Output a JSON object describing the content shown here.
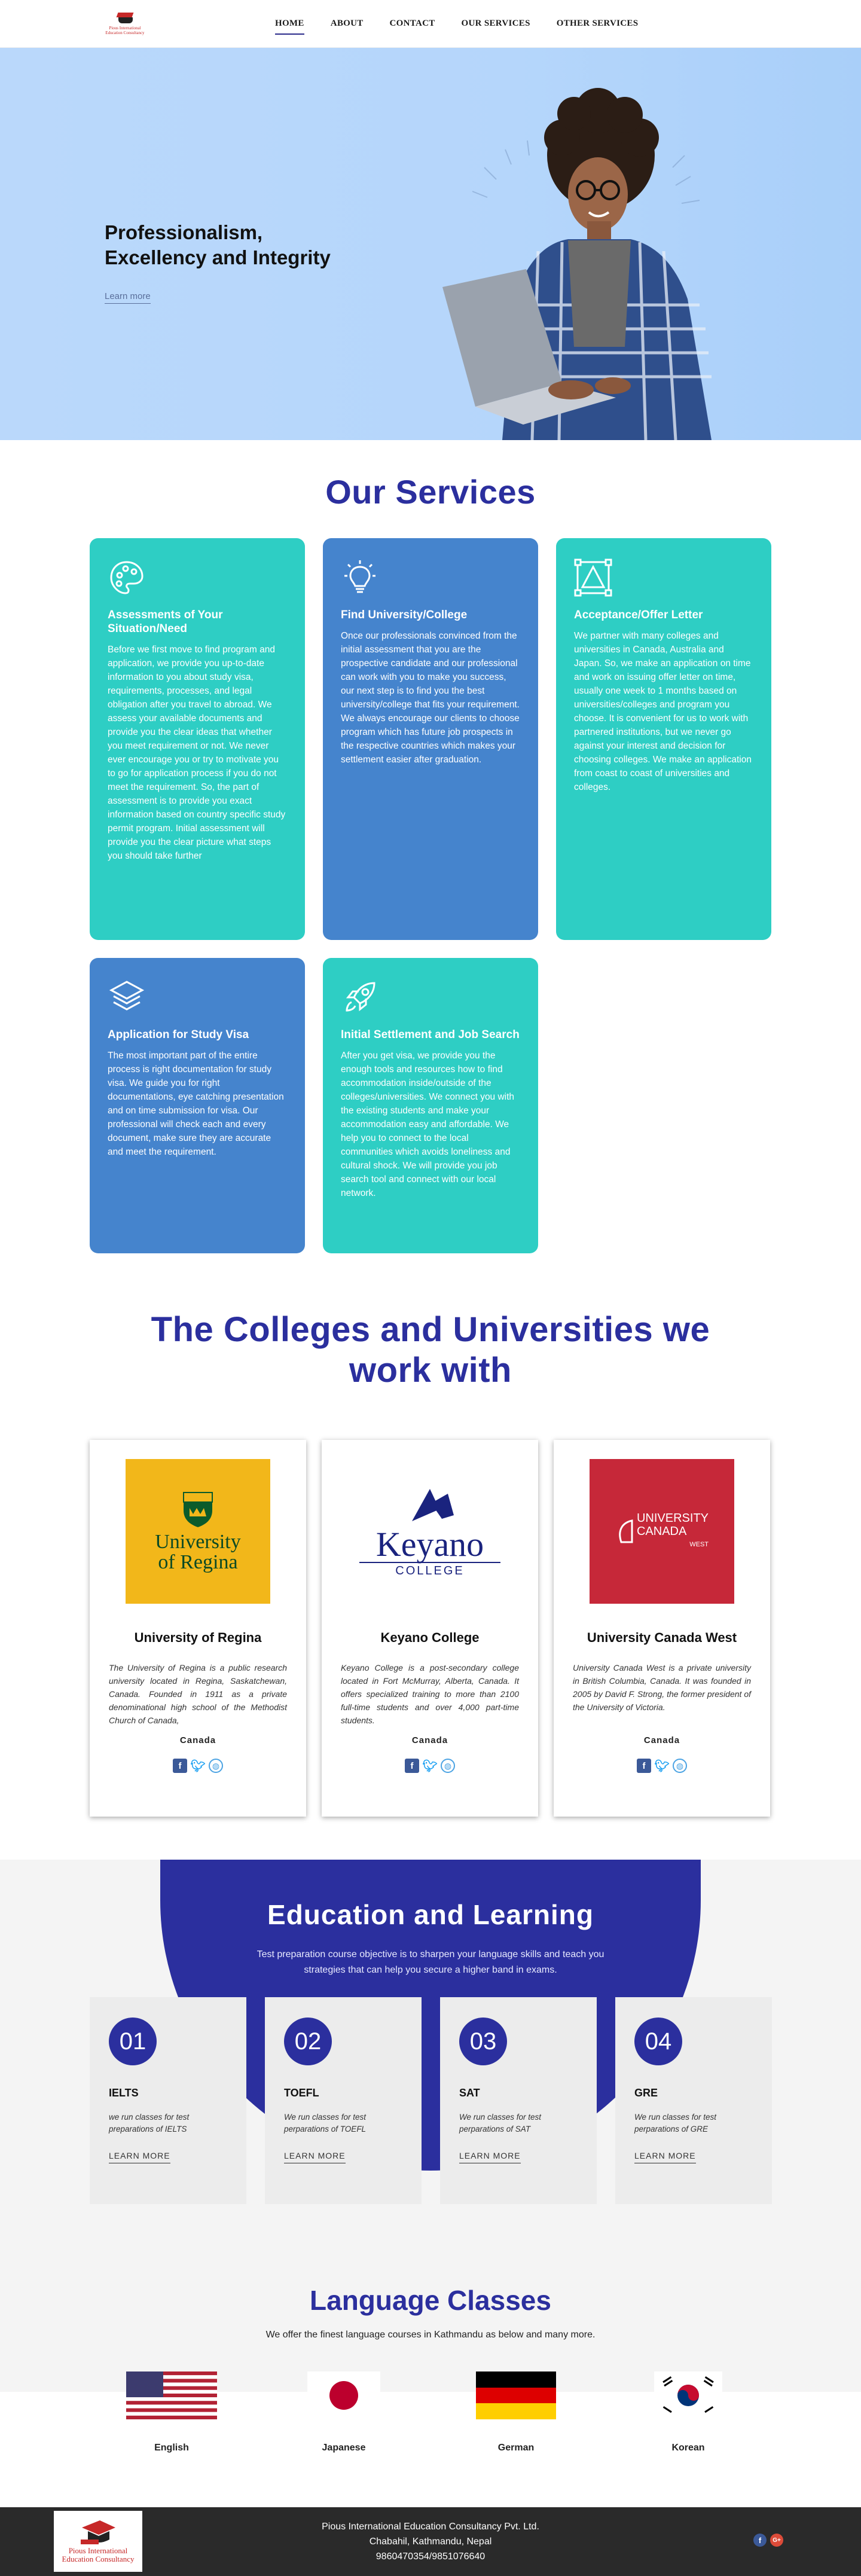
{
  "brand": {
    "logo_line1": "Pious International",
    "logo_line2": "Education Consultancy"
  },
  "nav": {
    "items": [
      "HOME",
      "ABOUT",
      "CONTACT",
      "OUR SERVICES",
      "OTHER SERVICES"
    ]
  },
  "hero": {
    "heading_line1": "Professionalism,",
    "heading_line2": "Excellency and Integrity",
    "cta": "Learn more"
  },
  "services": {
    "title": "Our Services",
    "cards": [
      {
        "title": "Assessments of Your Situation/Need",
        "icon": "palette-icon",
        "color": "#2ecec4",
        "text": "Before we first move to find program and application, we provide you up-to-date information to you about study visa, requirements, processes, and legal obligation after you travel to abroad. We assess your available documents and provide you the clear ideas that whether you meet requirement or not. We never ever encourage you or try to motivate you to go for application process if you do not meet the requirement. So, the part of assessment is to provide you exact information based on country specific study permit program. Initial assessment will provide you the clear picture what steps you should take further"
      },
      {
        "title": "Find University/College",
        "icon": "lightbulb-icon",
        "color": "#4584cd",
        "text": "Once our professionals convinced from the initial assessment that you are the prospective candidate and our professional can work with you to make you success, our next step is to find you the best university/college that fits your requirement. We always encourage our clients to choose program which has future job prospects in the respective countries which makes your settlement easier after graduation."
      },
      {
        "title": "Acceptance/Offer Letter",
        "icon": "vector-triangle-icon",
        "color": "#2ecec4",
        "text": "We partner with many colleges and universities in Canada, Australia and Japan. So, we make an application on time and work on issuing offer letter on time, usually one week to 1 months based on universities/colleges and program you choose. It is convenient for us to work with partnered institutions, but we never go against your interest and decision for choosing colleges. We make an application from coast to coast of universities and colleges."
      },
      {
        "title": "Application for Study Visa",
        "icon": "layers-icon",
        "color": "#4584cd",
        "text": "The most important part of the entire process is right documentation for study visa. We guide you for right documentations, eye catching presentation and on time submission for visa. Our professional will check each and every document, make sure they are accurate and meet the requirement."
      },
      {
        "title": "Initial Settlement and Job Search",
        "icon": "rocket-icon",
        "color": "#2ecec4",
        "text": "After you get visa, we provide you the enough tools and resources how to find accommodation inside/outside of the colleges/universities. We connect you with the existing students and make your accommodation easy and affordable. We help you to connect to the local communities which avoids loneliness and cultural shock. We will provide you job search tool and connect with our local network."
      }
    ]
  },
  "colleges": {
    "title": "The Colleges and Universities we work with",
    "items": [
      {
        "name": "University of Regina",
        "logo_line1": "University",
        "logo_line2": "of Regina",
        "country": "Canada",
        "desc": "The University of Regina is a public research university located in Regina, Saskatchewan, Canada. Founded in 1911 as a private denominational high school of the Methodist Church of Canada,"
      },
      {
        "name": "Keyano College",
        "logo_line1": "Keyano",
        "logo_line2": "COLLEGE",
        "country": "Canada",
        "desc": "Keyano College is a post-secondary college located in Fort McMurray, Alberta, Canada. It offers specialized training to more than 2100 full-time students and over 4,000 part-time students."
      },
      {
        "name": "University Canada West",
        "logo_line1": "UNIVERSITY",
        "logo_line2": "CANADA",
        "logo_line3": "WEST",
        "country": "Canada",
        "desc": "University Canada West is a private university in British Columbia, Canada. It was founded in 2005 by David F. Strong, the former president of the University of Victoria."
      }
    ]
  },
  "education": {
    "title": "Education and Learning",
    "subtitle": "Test preparation course objective is to sharpen your language skills and teach you strategies that can help you secure a higher band in exams.",
    "items": [
      {
        "num": "01",
        "name": "IELTS",
        "desc": "we run classes for test preparations of IELTS",
        "link": "LEARN MORE"
      },
      {
        "num": "02",
        "name": "TOEFL",
        "desc": "We run classes for test perparations of TOEFL",
        "link": "LEARN MORE"
      },
      {
        "num": "03",
        "name": "SAT",
        "desc": "We run classes for test perparations of SAT",
        "link": "LEARN MORE"
      },
      {
        "num": "04",
        "name": "GRE",
        "desc": "We run classes for test perparations of GRE",
        "link": "LEARN MORE"
      }
    ]
  },
  "languages": {
    "title": "Language Classes",
    "subtitle": "We offer the finest language courses in Kathmandu as below and many more.",
    "items": [
      "English",
      "Japanese",
      "German",
      "Korean"
    ]
  },
  "footer": {
    "company": "Pious International Education Consultancy Pvt. Ltd.",
    "address": "Chabahil, Kathmandu, Nepal",
    "phone": "9860470354/9851076640"
  },
  "colors": {
    "primary": "#2b2f9e",
    "teal": "#2ecec4",
    "blue": "#4584cd"
  }
}
